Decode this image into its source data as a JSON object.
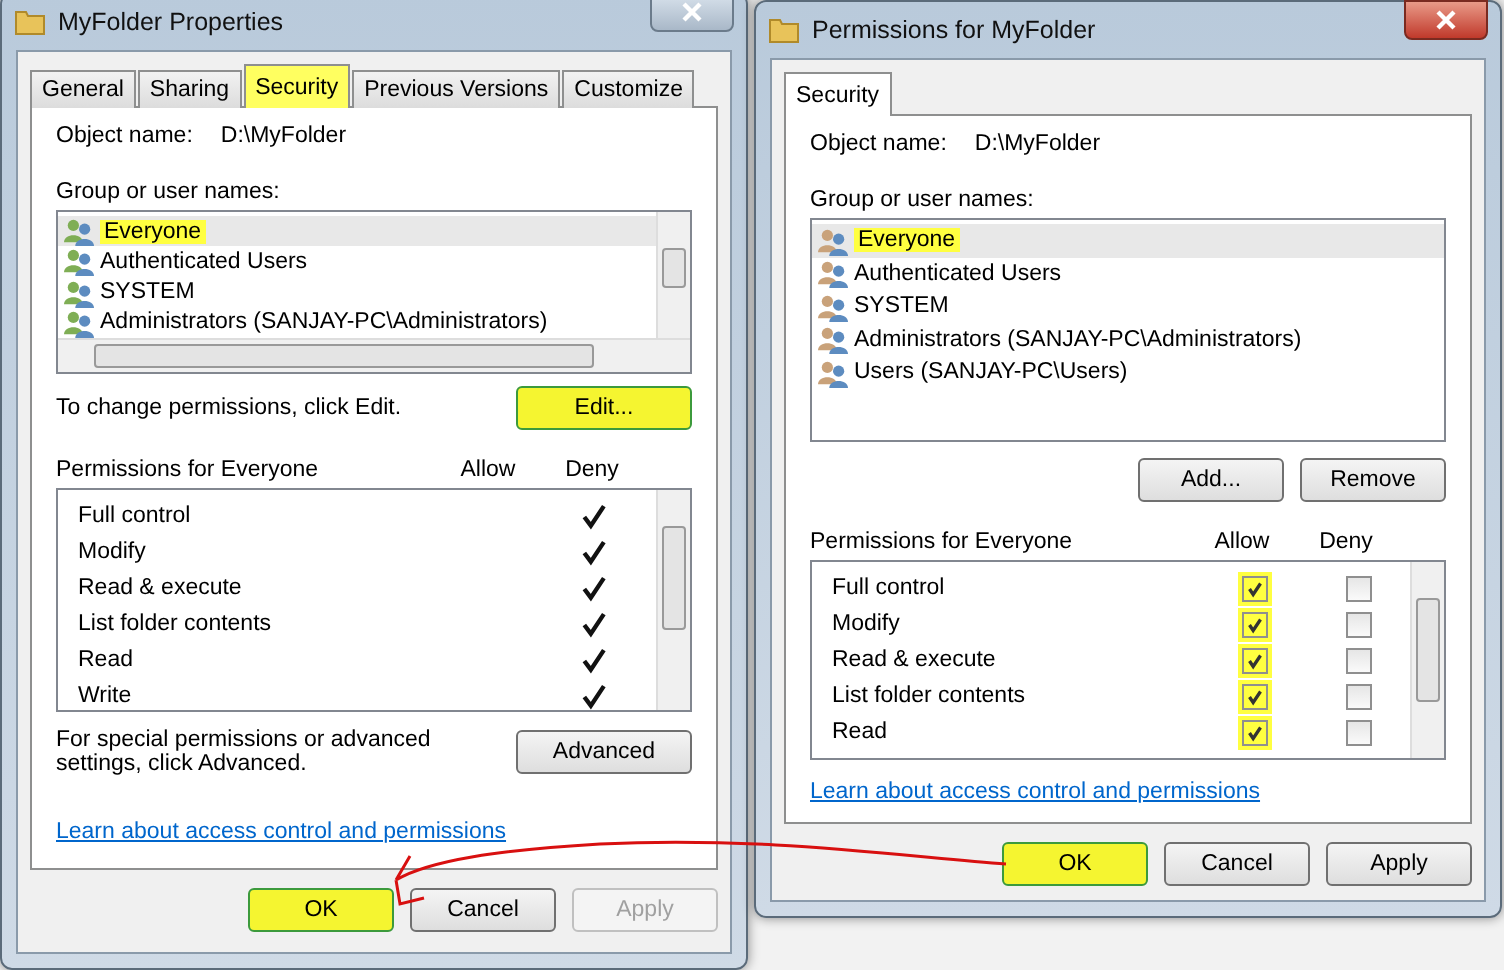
{
  "properties_window": {
    "title": "MyFolder Properties",
    "tabs": [
      {
        "label": "General",
        "selected": false,
        "highlighted": false
      },
      {
        "label": "Sharing",
        "selected": false,
        "highlighted": false
      },
      {
        "label": "Security",
        "selected": true,
        "highlighted": true
      },
      {
        "label": "Previous Versions",
        "selected": false,
        "highlighted": false
      },
      {
        "label": "Customize",
        "selected": false,
        "highlighted": false
      }
    ],
    "object_name_label": "Object name:",
    "object_name": "D:\\MyFolder",
    "groups_label": "Group or user names:",
    "groups": [
      {
        "name": "Everyone",
        "selected": true,
        "highlighted": true
      },
      {
        "name": "Authenticated Users",
        "selected": false,
        "highlighted": false
      },
      {
        "name": "SYSTEM",
        "selected": false,
        "highlighted": false
      },
      {
        "name": "Administrators (SANJAY-PC\\Administrators)",
        "selected": false,
        "highlighted": false
      }
    ],
    "change_hint": "To change permissions, click Edit.",
    "edit_button": {
      "label": "Edit...",
      "highlighted": true
    },
    "permissions_label": "Permissions for Everyone",
    "allow_header": "Allow",
    "deny_header": "Deny",
    "permissions": [
      {
        "name": "Full control",
        "deny": true
      },
      {
        "name": "Modify",
        "deny": true
      },
      {
        "name": "Read & execute",
        "deny": true
      },
      {
        "name": "List folder contents",
        "deny": true
      },
      {
        "name": "Read",
        "deny": true
      },
      {
        "name": "Write",
        "deny": true
      }
    ],
    "advanced_hint": "For special permissions or advanced settings, click Advanced.",
    "advanced_button": "Advanced",
    "link": "Learn about access control and permissions",
    "buttons": [
      {
        "label": "OK",
        "disabled": false,
        "highlighted": true
      },
      {
        "label": "Cancel",
        "disabled": false,
        "highlighted": false
      },
      {
        "label": "Apply",
        "disabled": true,
        "highlighted": false
      }
    ]
  },
  "permissions_window": {
    "title": "Permissions for MyFolder",
    "tabs": [
      {
        "label": "Security",
        "selected": true,
        "highlighted": false
      }
    ],
    "object_name_label": "Object name:",
    "object_name": "D:\\MyFolder",
    "groups_label": "Group or user names:",
    "groups": [
      {
        "name": "Everyone",
        "selected": true,
        "highlighted": true
      },
      {
        "name": "Authenticated Users",
        "selected": false,
        "highlighted": false
      },
      {
        "name": "SYSTEM",
        "selected": false,
        "highlighted": false
      },
      {
        "name": "Administrators (SANJAY-PC\\Administrators)",
        "selected": false,
        "highlighted": false
      },
      {
        "name": "Users (SANJAY-PC\\Users)",
        "selected": false,
        "highlighted": false
      }
    ],
    "add_button": "Add...",
    "remove_button": "Remove",
    "permissions_label": "Permissions for Everyone",
    "allow_header": "Allow",
    "deny_header": "Deny",
    "permissions": [
      {
        "name": "Full control",
        "allow": true,
        "deny": false,
        "highlighted": true
      },
      {
        "name": "Modify",
        "allow": true,
        "deny": false,
        "highlighted": true
      },
      {
        "name": "Read & execute",
        "allow": true,
        "deny": false,
        "highlighted": true
      },
      {
        "name": "List folder contents",
        "allow": true,
        "deny": false,
        "highlighted": true
      },
      {
        "name": "Read",
        "allow": true,
        "deny": false,
        "highlighted": true
      }
    ],
    "link": "Learn about access control and permissions",
    "buttons": [
      {
        "label": "OK",
        "disabled": false,
        "highlighted": true
      },
      {
        "label": "Cancel",
        "disabled": false,
        "highlighted": false
      },
      {
        "label": "Apply",
        "disabled": false,
        "highlighted": false
      }
    ]
  }
}
